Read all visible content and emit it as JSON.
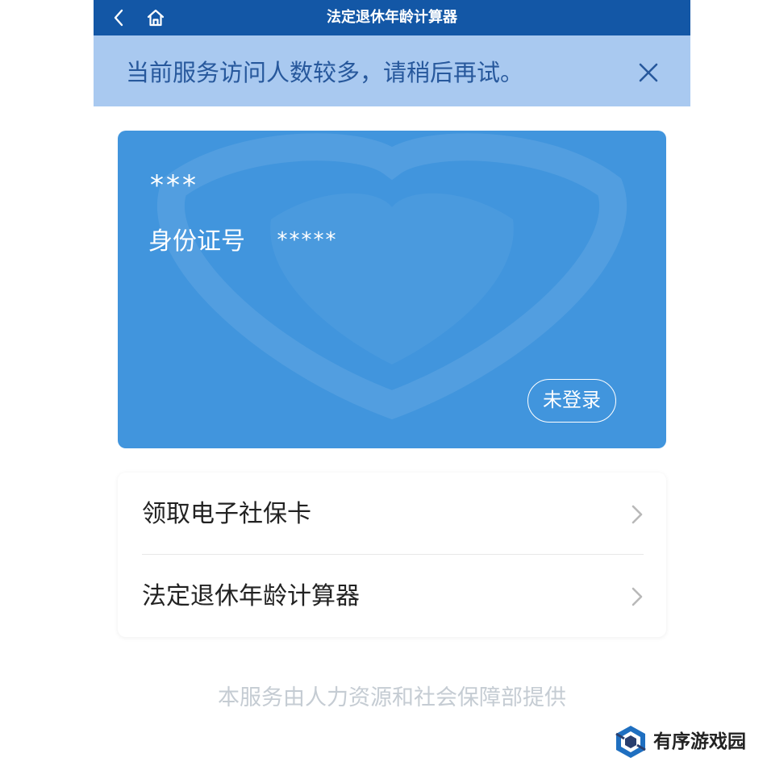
{
  "topbar": {
    "title": "法定退休年龄计算器",
    "back_icon": "chevron-left-icon",
    "home_icon": "home-icon",
    "background": "#1357a6"
  },
  "notice": {
    "text": "当前服务访问人数较多，请稍后再试。",
    "close_icon": "close-icon",
    "background": "#a9c9f0",
    "text_color": "#27589c"
  },
  "card": {
    "name": "***",
    "id_label": "身份证号",
    "id_value": "*****",
    "login_label": "未登录",
    "background": "#4195dd"
  },
  "list": {
    "items": [
      {
        "label": "领取电子社保卡",
        "icon": "chevron-right-icon"
      },
      {
        "label": "法定退休年龄计算器",
        "icon": "chevron-right-icon"
      }
    ]
  },
  "footer": {
    "text": "本服务由人力资源和社会保障部提供"
  },
  "brand_watermark": {
    "text": "有序游戏园",
    "icon": "brand-logo-icon"
  }
}
